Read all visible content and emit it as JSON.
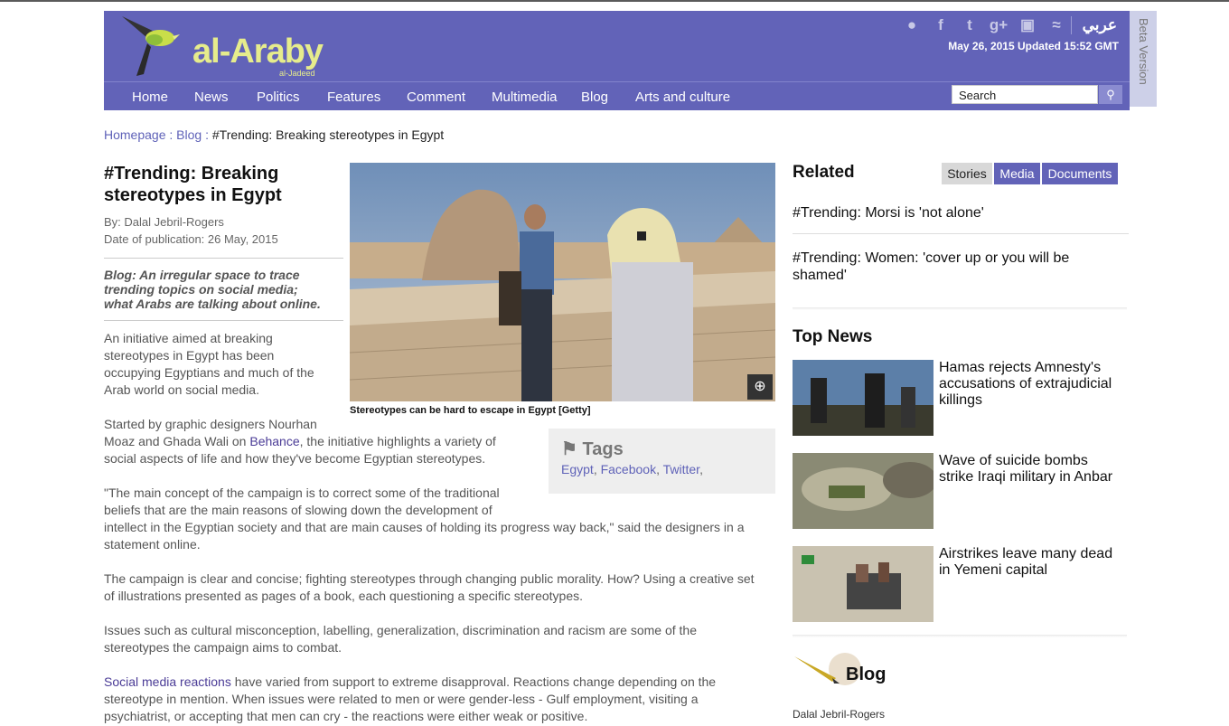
{
  "brand": {
    "logo_main": "al-Araby",
    "logo_sub": "al-Jadeed"
  },
  "header": {
    "social_icons": [
      "camera-icon",
      "facebook-icon",
      "twitter-icon",
      "google-plus-icon",
      "instagram-icon",
      "rss-icon"
    ],
    "language_link": "عربي",
    "date_line": "May 26, 2015 Updated 15:52 GMT",
    "beta": "Beta Version"
  },
  "nav": [
    "Home",
    "News",
    "Politics",
    "Features",
    "Comment",
    "Multimedia",
    "Blog",
    "Arts and culture"
  ],
  "search": {
    "placeholder": "Search"
  },
  "breadcrumb": {
    "home": "Homepage",
    "sep": " : ",
    "section": "Blog",
    "current": "#Trending: Breaking stereotypes in Egypt"
  },
  "article": {
    "title": "#Trending: Breaking stereotypes in Egypt",
    "author": "By: Dalal Jebril-Rogers",
    "date": "Date of publication: 26 May, 2015",
    "standfirst": "Blog: An irregular space to trace trending topics on social media; what Arabs are talking about online.",
    "caption": "Stereotypes can be hard to escape in Egypt [Getty]",
    "p1_lines": [
      "An initiative aimed at breaking",
      "stereotypes in Egypt has been",
      "occupying Egyptians and much of the",
      "Arab world on social media."
    ],
    "p2_line1": "Started by graphic designers Nourhan",
    "p2_line2_pre": "Moaz and Ghada Wali on ",
    "p2_link": "Behance",
    "p2_line2_post": ", the initiative highlights a variety of",
    "p2_line3": "social aspects of life and how they've become Egyptian stereotypes.",
    "p3_lines": [
      "\"The main concept of the campaign is to correct some of the traditional",
      "beliefs that are the main reasons of slowing down the development of",
      "intellect in the Egyptian society and that are main causes of holding its progress way back,\" said the designers in a",
      "statement online."
    ],
    "p4_lines": [
      "The campaign is clear and concise; fighting stereotypes through changing public morality. How? Using a creative set",
      "of illustrations presented as pages of a book, each questioning a specific stereotypes."
    ],
    "p5_lines": [
      "Issues such as cultural misconception, labelling, generalization, discrimination and racism are some of the",
      "stereotypes the campaign aims to combat."
    ],
    "p6_link": "Social media reactions",
    "p6_line1_post": " have varied from support to extreme disapproval. Reactions change depending on the",
    "p6_line2": "stereotype in mention. When issues were related to men or were gender-less - Gulf employment, visiting a",
    "p6_line3": "psychiatrist, or accepting that men can cry - the reactions were either weak or positive."
  },
  "tags": {
    "title": "Tags",
    "items": [
      "Egypt",
      "Facebook",
      "Twitter"
    ]
  },
  "related": {
    "title": "Related",
    "tabs": [
      "Stories",
      "Media",
      "Documents"
    ],
    "items": [
      "#Trending: Morsi is 'not alone'",
      "#Trending: Women: 'cover up or you will be shamed'"
    ]
  },
  "top_news": {
    "title": "Top News",
    "items": [
      "Hamas rejects Amnesty's accusations of extrajudicial killings",
      "Wave of suicide bombs strike Iraqi military in Anbar",
      "Airstrikes leave many dead in Yemeni capital"
    ]
  },
  "blog": {
    "label": "Blog",
    "author": "Dalal Jebril-Rogers"
  },
  "colors": {
    "header": "#6263b8",
    "link": "#5f62b8",
    "tab_active": "#6263b8",
    "tab_inactive": "#d8d8d8"
  }
}
